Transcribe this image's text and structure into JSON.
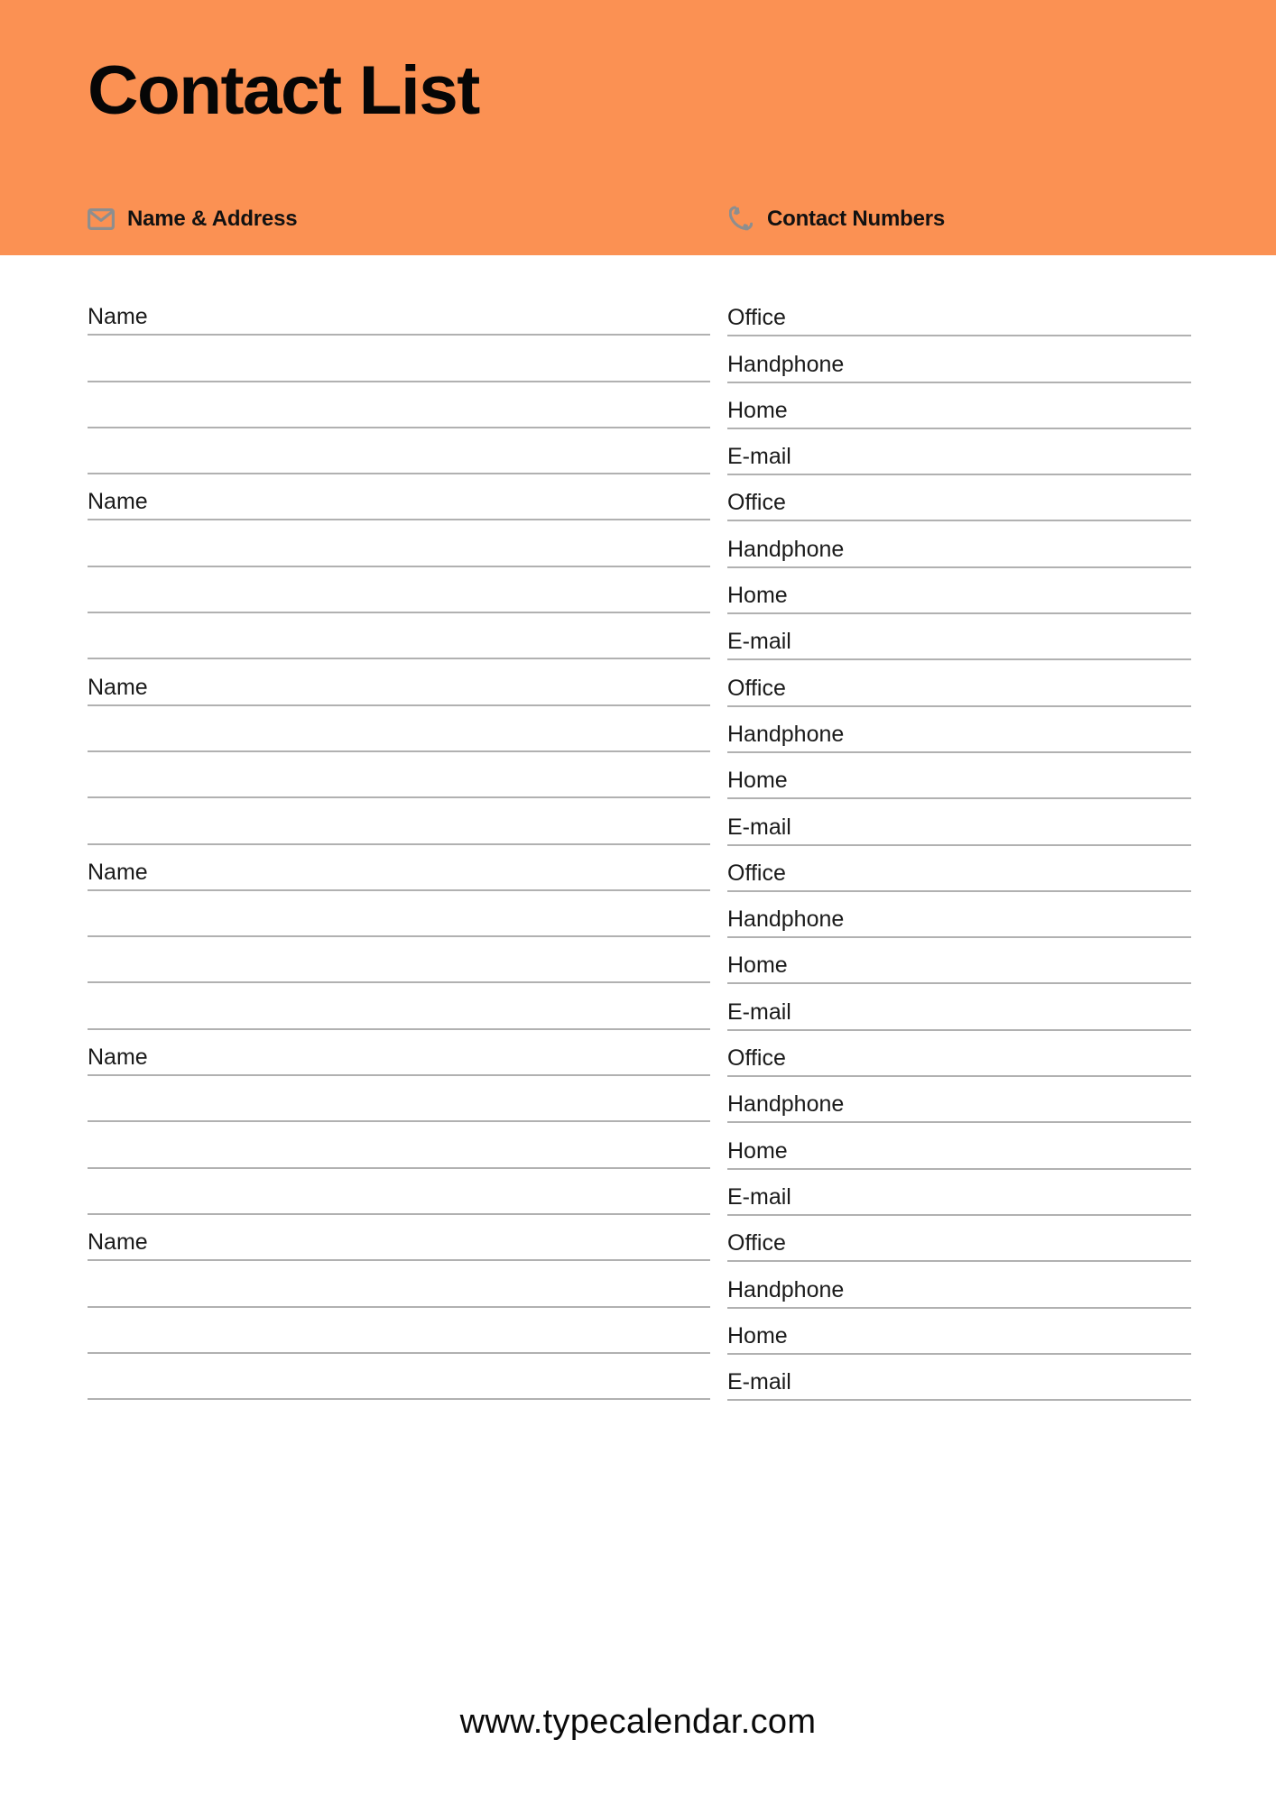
{
  "page": {
    "title": "Contact List",
    "accent_color": "#fb9153",
    "line_color": "#b1b1b1",
    "text_color": "#1a1a1a",
    "icon_color": "#8e8e8e"
  },
  "header": {
    "title": "Contact List",
    "columns": [
      {
        "icon": "envelope-icon",
        "label": "Name & Address"
      },
      {
        "icon": "phone-icon",
        "label": "Contact Numbers"
      }
    ]
  },
  "form": {
    "left_column": {
      "header": "Name & Address",
      "blocks": [
        {
          "lines": [
            "Name",
            "",
            "",
            ""
          ]
        },
        {
          "lines": [
            "Name",
            "",
            "",
            ""
          ]
        },
        {
          "lines": [
            "Name",
            "",
            "",
            ""
          ]
        },
        {
          "lines": [
            "Name",
            "",
            "",
            ""
          ]
        },
        {
          "lines": [
            "Name",
            "",
            "",
            ""
          ]
        },
        {
          "lines": [
            "Name",
            "",
            "",
            ""
          ]
        }
      ]
    },
    "right_column": {
      "header": "Contact Numbers",
      "blocks": [
        {
          "lines": [
            "Office",
            "Handphone",
            "Home",
            "E-mail"
          ]
        },
        {
          "lines": [
            "Office",
            "Handphone",
            "Home",
            "E-mail"
          ]
        },
        {
          "lines": [
            "Office",
            "Handphone",
            "Home",
            "E-mail"
          ]
        },
        {
          "lines": [
            "Office",
            "Handphone",
            "Home",
            "E-mail"
          ]
        },
        {
          "lines": [
            "Office",
            "Handphone",
            "Home",
            "E-mail"
          ]
        },
        {
          "lines": [
            "Office",
            "Handphone",
            "Home",
            "E-mail"
          ]
        }
      ]
    }
  },
  "footer": {
    "url": "www.typecalendar.com"
  }
}
